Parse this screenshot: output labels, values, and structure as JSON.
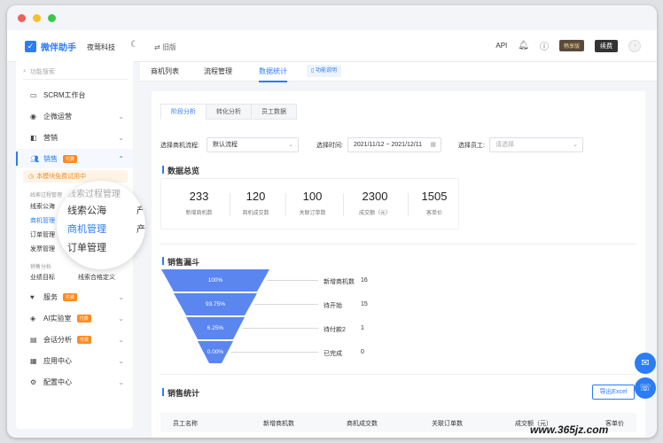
{
  "app": {
    "name": "微伴助手",
    "company": "夜莺科技",
    "old_version": "旧版"
  },
  "topbar": {
    "api": "API",
    "vip_badge": "畅享版",
    "renew": "续费"
  },
  "sidebar": {
    "search_placeholder": "功能搜索",
    "items": [
      {
        "label": "SCRM工作台"
      },
      {
        "label": "企微运营"
      },
      {
        "label": "营销"
      },
      {
        "label": "销售",
        "tag": "付费"
      },
      {
        "label": "服务",
        "tag": "付费"
      },
      {
        "label": "AI实验室",
        "tag": "付费"
      },
      {
        "label": "会话分析",
        "tag": "付费"
      },
      {
        "label": "应用中心"
      },
      {
        "label": "配置中心"
      }
    ],
    "trial_notice": "本模块免费试用中",
    "sub_group_1": "线索过程管理",
    "sub_items_1": [
      "线索公海",
      "商机管理",
      "订单管理",
      "发票管理"
    ],
    "sub_group_2": "销售分析",
    "sub_items_2": [
      "业绩目标",
      "线索合格定义"
    ]
  },
  "magnifier": {
    "items": [
      "线索过程管理",
      "线索公海",
      "商机管理",
      "订单管理"
    ],
    "cut_right": [
      "产",
      "产"
    ]
  },
  "top_tabs": [
    "商机列表",
    "流程管理",
    "数据统计"
  ],
  "help_tab": "功能说明",
  "sub_tabs": [
    "阶段分析",
    "转化分析",
    "员工数据"
  ],
  "filters": {
    "process_label": "选择商机流程:",
    "process_value": "默认流程",
    "time_label": "选择时间:",
    "time_value": "2021/11/12 ~ 2021/12/11",
    "staff_label": "选择员工:",
    "staff_placeholder": "请选择"
  },
  "overview": {
    "title": "数据总览",
    "stats": [
      {
        "value": "233",
        "label": "新增商机数"
      },
      {
        "value": "120",
        "label": "商机成交数"
      },
      {
        "value": "100",
        "label": "关联订单数"
      },
      {
        "value": "2300",
        "label": "成交额（元）"
      },
      {
        "value": "1505",
        "label": "客单价"
      }
    ]
  },
  "funnel": {
    "title": "销售漏斗",
    "color": "#5b86f0",
    "stages": [
      {
        "pct": "100%",
        "name": "新增商机数",
        "count": "16"
      },
      {
        "pct": "93.75%",
        "name": "待开始",
        "count": "15"
      },
      {
        "pct": "6.25%",
        "name": "待付款2",
        "count": "1"
      },
      {
        "pct": "0.00%",
        "name": "已完成",
        "count": "0"
      }
    ]
  },
  "stats_section": {
    "title": "销售统计",
    "export": "导出Excel",
    "columns": [
      "员工名称",
      "新增商机数",
      "商机成交数",
      "关联订单数",
      "成交额（元）",
      "客单价"
    ]
  },
  "watermark": "www.365jz.com"
}
